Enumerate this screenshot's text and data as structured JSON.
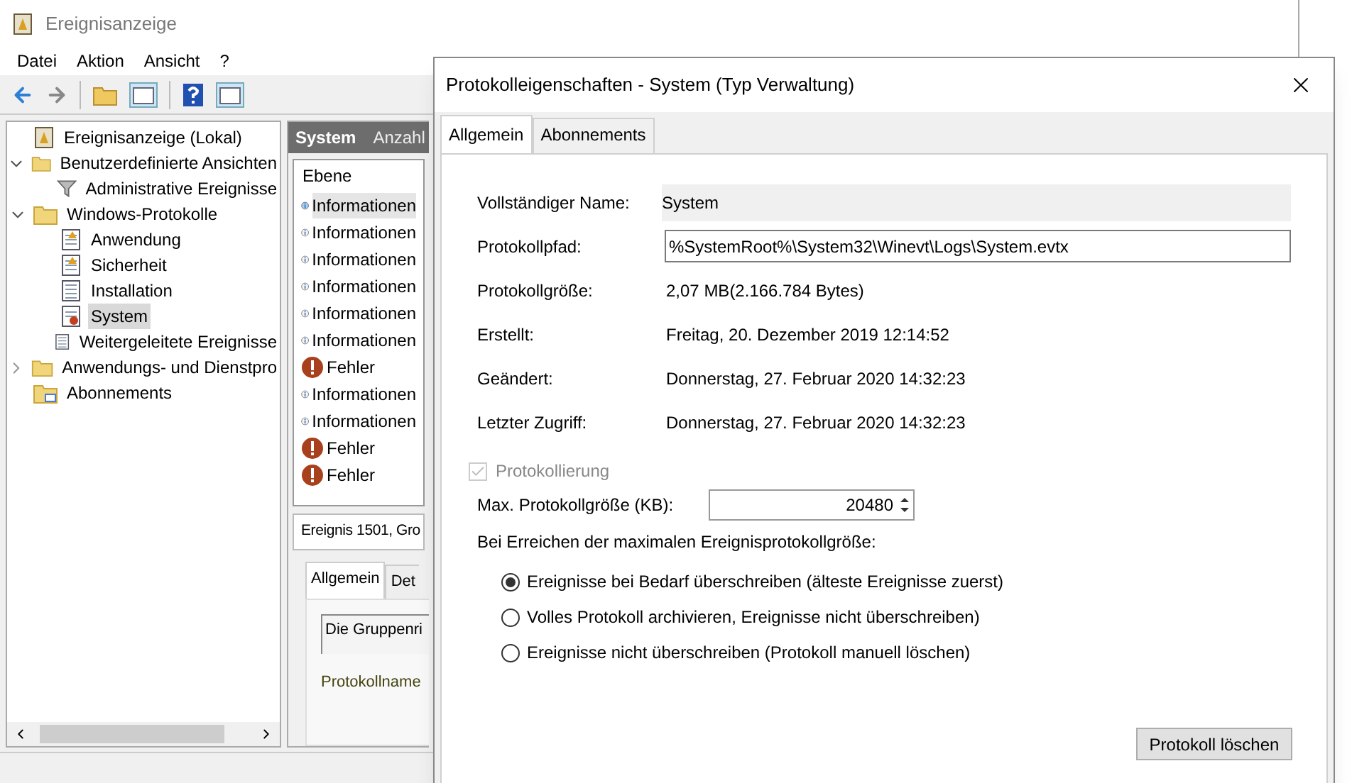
{
  "window": {
    "title": "Ereignisanzeige"
  },
  "menu": [
    "Datei",
    "Aktion",
    "Ansicht",
    "?"
  ],
  "tree": [
    {
      "label": "Ereignisanzeige (Lokal)",
      "kind": "root",
      "selected": false,
      "children": [
        {
          "label": "Benutzerdefinierte Ansichten",
          "kind": "folder",
          "expanded": true,
          "selected": false,
          "children": [
            {
              "label": "Administrative Ereignisse",
              "kind": "filter",
              "selected": false
            }
          ]
        },
        {
          "label": "Windows-Protokolle",
          "kind": "folder",
          "expanded": true,
          "selected": false,
          "children": [
            {
              "label": "Anwendung",
              "kind": "log",
              "selected": false
            },
            {
              "label": "Sicherheit",
              "kind": "log",
              "selected": false
            },
            {
              "label": "Installation",
              "kind": "plain",
              "selected": false
            },
            {
              "label": "System",
              "kind": "system",
              "selected": true
            },
            {
              "label": "Weitergeleitete Ereignisse",
              "kind": "plain",
              "selected": false
            }
          ]
        },
        {
          "label": "Anwendungs- und Dienstpro",
          "kind": "folder",
          "expanded": false,
          "selected": false
        },
        {
          "label": "Abonnements",
          "kind": "subs",
          "selected": false
        }
      ]
    }
  ],
  "log_header": {
    "title": "System",
    "count": "Anzahl"
  },
  "events": {
    "column": "Ebene",
    "rows": [
      {
        "level": "Informationen",
        "kind": "info",
        "selected": true
      },
      {
        "level": "Informationen",
        "kind": "info",
        "selected": false
      },
      {
        "level": "Informationen",
        "kind": "info",
        "selected": false
      },
      {
        "level": "Informationen",
        "kind": "info",
        "selected": false
      },
      {
        "level": "Informationen",
        "kind": "info",
        "selected": false
      },
      {
        "level": "Informationen",
        "kind": "info",
        "selected": false
      },
      {
        "level": "Fehler",
        "kind": "error",
        "selected": false
      },
      {
        "level": "Informationen",
        "kind": "info",
        "selected": false
      },
      {
        "level": "Informationen",
        "kind": "info",
        "selected": false
      },
      {
        "level": "Fehler",
        "kind": "error",
        "selected": false
      },
      {
        "level": "Fehler",
        "kind": "error",
        "selected": false
      }
    ]
  },
  "detail": {
    "title": "Ereignis 1501, Gro",
    "tabs": [
      {
        "label": "Allgemein",
        "selected": true
      },
      {
        "label": "Det",
        "selected": false
      }
    ],
    "message": "Die Gruppenri",
    "field": "Protokollname"
  },
  "dialog": {
    "title": "Protokolleigenschaften - System (Typ Verwaltung)",
    "tabs": [
      {
        "label": "Allgemein",
        "selected": true
      },
      {
        "label": "Abonnements",
        "selected": false
      }
    ],
    "fields": [
      {
        "label": "Vollständiger Name:",
        "value": "System",
        "kind": "readonly"
      },
      {
        "label": "Protokollpfad:",
        "value": "%SystemRoot%\\System32\\Winevt\\Logs\\System.evtx",
        "kind": "input"
      },
      {
        "label": "Protokollgröße:",
        "value": "2,07 MB(2.166.784 Bytes)",
        "kind": "text"
      },
      {
        "label": "Erstellt:",
        "value": "Freitag, 20. Dezember 2019 12:14:52",
        "kind": "text"
      },
      {
        "label": "Geändert:",
        "value": "Donnerstag, 27. Februar 2020 14:32:23",
        "kind": "text"
      },
      {
        "label": "Letzter Zugriff:",
        "value": "Donnerstag, 27. Februar 2020 14:32:23",
        "kind": "text"
      }
    ],
    "logging": {
      "label": "Protokollierung",
      "checked": true,
      "disabled": true
    },
    "max_size": {
      "label": "Max. Protokollgröße (KB):",
      "value": "20480"
    },
    "policy_label": "Bei Erreichen der maximalen Ereignisprotokollgröße:",
    "options": [
      {
        "label": "Ereignisse bei Bedarf überschreiben (älteste Ereignisse zuerst)",
        "selected": true
      },
      {
        "label": "Volles Protokoll archivieren, Ereignisse nicht überschreiben)",
        "selected": false
      },
      {
        "label": "Ereignisse nicht überschreiben (Protokoll manuell löschen)",
        "selected": false
      }
    ],
    "clear_button": "Protokoll löschen"
  }
}
